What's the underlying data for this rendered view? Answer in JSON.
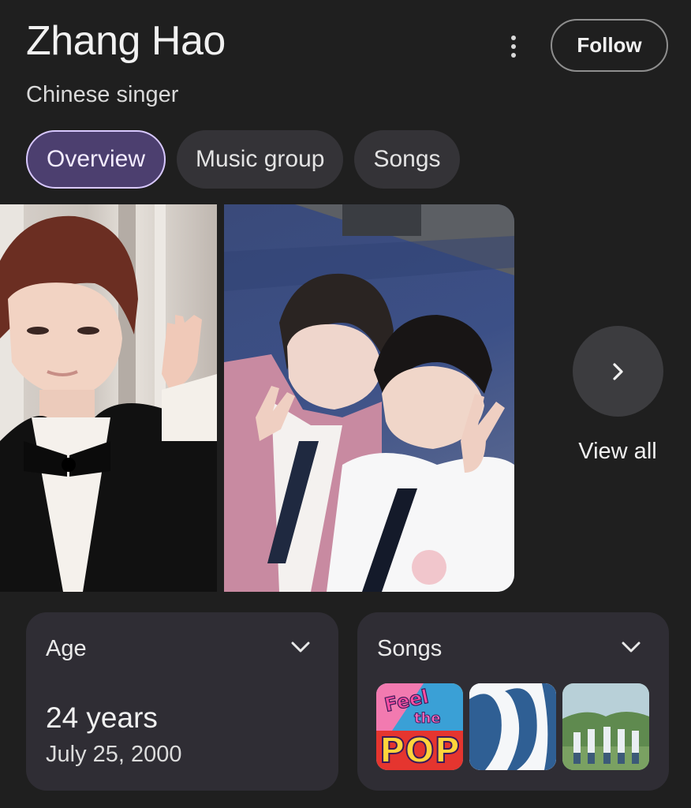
{
  "header": {
    "title": "Zhang Hao",
    "subtitle": "Chinese singer",
    "follow_label": "Follow"
  },
  "tabs": [
    {
      "label": "Overview",
      "active": true
    },
    {
      "label": "Music group",
      "active": false
    },
    {
      "label": "Songs",
      "active": false
    }
  ],
  "images": {
    "view_all_label": "View all"
  },
  "cards": {
    "age": {
      "label": "Age",
      "value": "24 years",
      "date": "July 25, 2000"
    },
    "songs": {
      "label": "Songs",
      "thumb1_text": "Feel the POP"
    }
  },
  "icons": {
    "more": "more-vertical-icon",
    "next": "chevron-right-icon",
    "expand": "chevron-down-icon"
  },
  "colors": {
    "background": "#1f1f1f",
    "active_tab": "#4c3f6f",
    "active_tab_border": "#d8c8ff",
    "card": "#2f2d34"
  }
}
